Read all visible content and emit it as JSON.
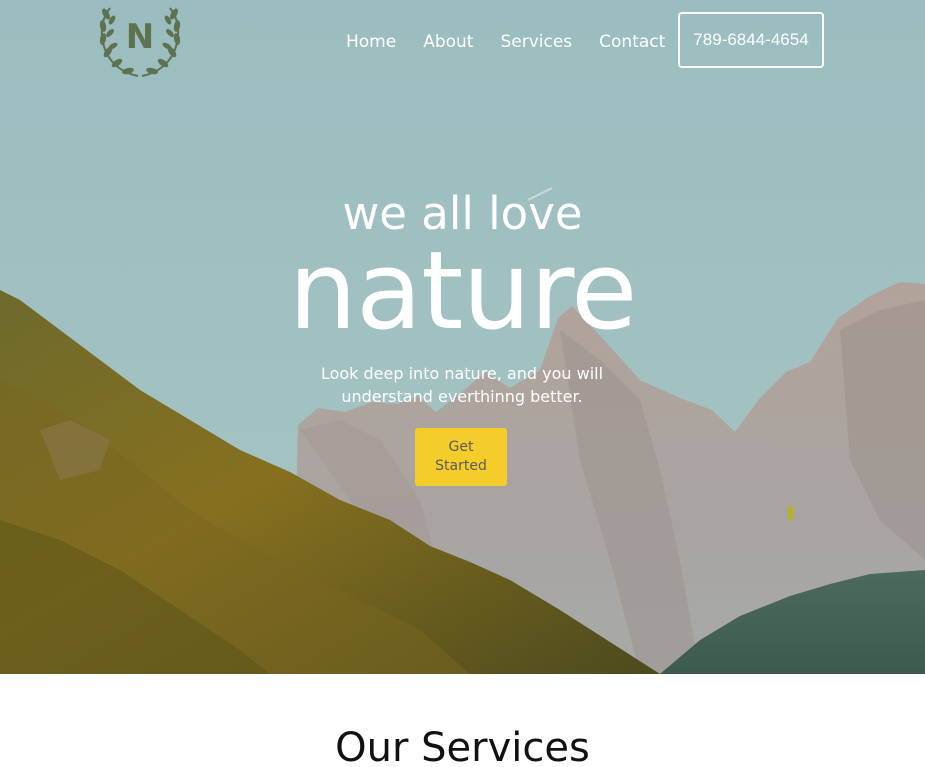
{
  "header": {
    "logo_letter": "N",
    "nav": [
      {
        "label": "Home"
      },
      {
        "label": "About"
      },
      {
        "label": "Services"
      },
      {
        "label": "Contact"
      }
    ],
    "phone": "789-6844-4654"
  },
  "hero": {
    "subtitle": "we all love",
    "title": "nature",
    "text": "Look deep into nature, and you will understand everthinng better.",
    "cta_label": "Get Started"
  },
  "services": {
    "title": "Our Services"
  },
  "colors": {
    "accent_yellow": "#f5cd2a",
    "logo_green": "#5e7250",
    "sky": "#9dbcbe"
  },
  "icons": {
    "logo": "laurel-wreath-icon"
  }
}
